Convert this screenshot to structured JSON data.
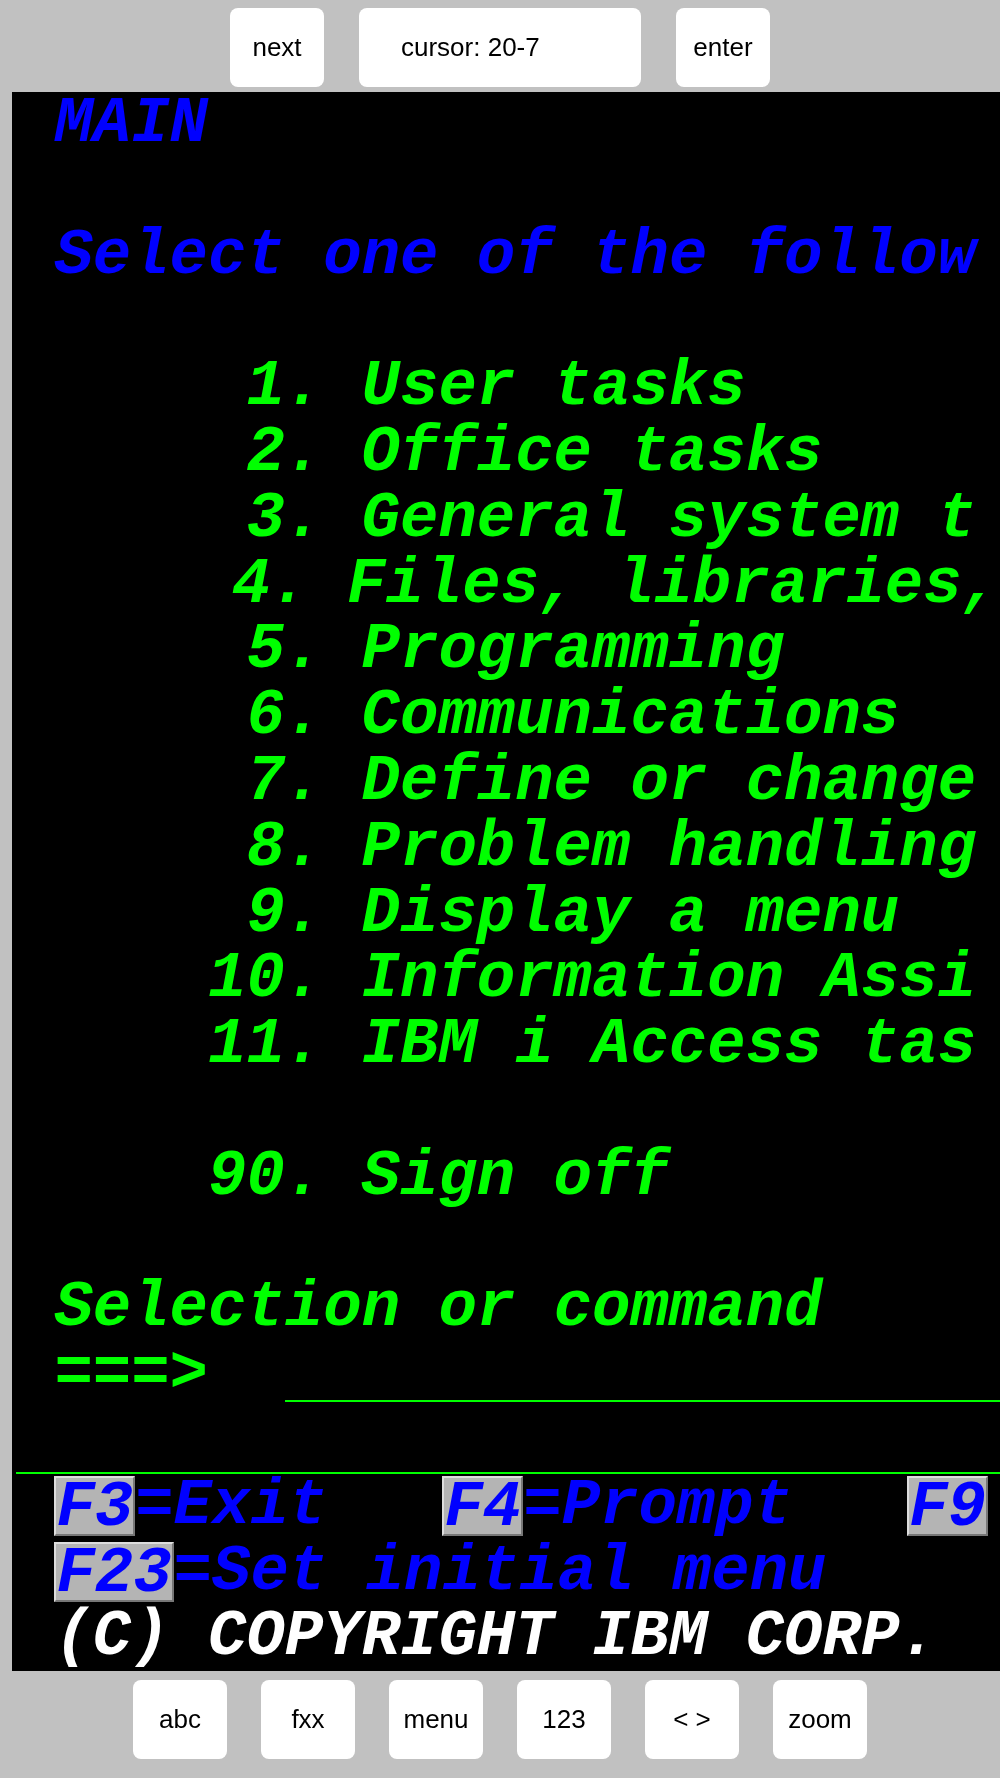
{
  "top_bar": {
    "next_button": "next",
    "cursor_field": "cursor: 20-7",
    "enter_button": "enter"
  },
  "screen": {
    "title": "MAIN",
    "prompt": "Select one of the follow",
    "option_groups": [
      [
        {
          "number": "1.",
          "label": "User tasks"
        },
        {
          "number": "2.",
          "label": "Office tasks"
        },
        {
          "number": "3.",
          "label": "General system t"
        },
        {
          "number": "4.",
          "label": "Files, libraries,"
        },
        {
          "number": "5.",
          "label": "Programming"
        },
        {
          "number": "6.",
          "label": "Communications"
        },
        {
          "number": "7.",
          "label": "Define or change"
        },
        {
          "number": "8.",
          "label": "Problem handling"
        },
        {
          "number": "9.",
          "label": "Display a menu"
        },
        {
          "number": "10.",
          "label": "Information Assi"
        },
        {
          "number": "11.",
          "label": "IBM i Access tas"
        }
      ],
      [
        {
          "number": "90.",
          "label": "Sign off"
        }
      ]
    ],
    "command_label": "Selection or command",
    "command_arrow": "===>",
    "function_key_rows": [
      [
        {
          "key": "F3",
          "label": "=Exit"
        },
        {
          "key": "F4",
          "label": "=Prompt"
        },
        {
          "key": "F9"
        }
      ],
      [
        {
          "key": "F23",
          "label": "=Set initial menu"
        }
      ]
    ],
    "copyright": "(C) COPYRIGHT IBM CORP."
  },
  "bottom_bar": [
    "abc",
    "fxx",
    "menu",
    "123",
    "< >",
    "zoom"
  ]
}
